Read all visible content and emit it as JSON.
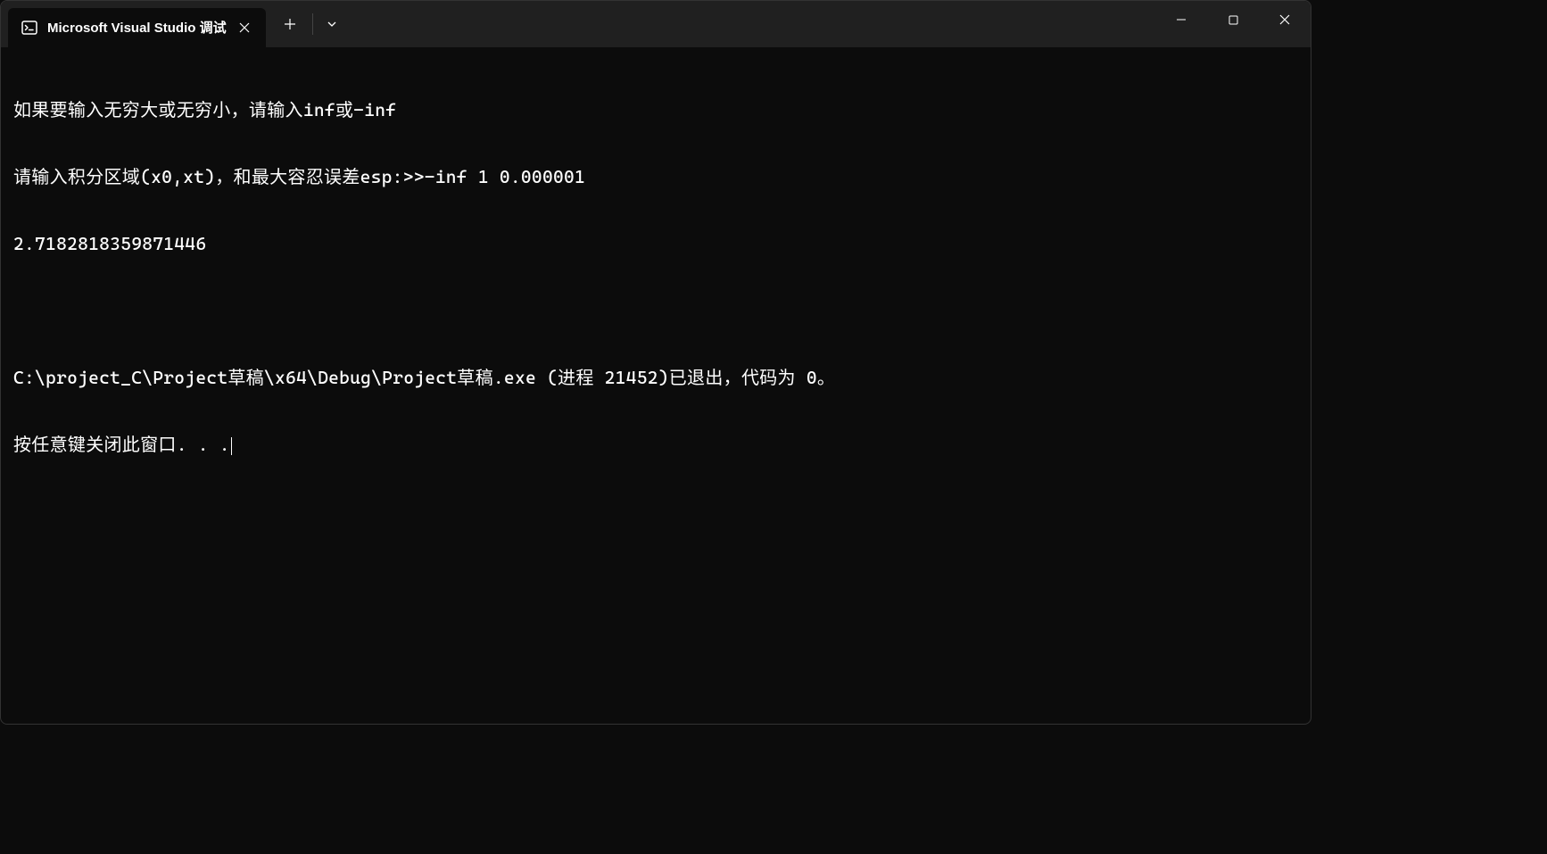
{
  "titlebar": {
    "tab_title": "Microsoft Visual Studio 调试"
  },
  "terminal": {
    "lines": [
      "如果要输入无穷大或无穷小，请输入inf或-inf",
      "请输入积分区域(x0,xt)，和最大容忍误差esp:>>-inf 1 0.000001",
      "2.7182818359871446",
      "",
      "C:\\project_C\\Project草稿\\x64\\Debug\\Project草稿.exe (进程 21452)已退出，代码为 0。",
      "按任意键关闭此窗口. . ."
    ]
  }
}
